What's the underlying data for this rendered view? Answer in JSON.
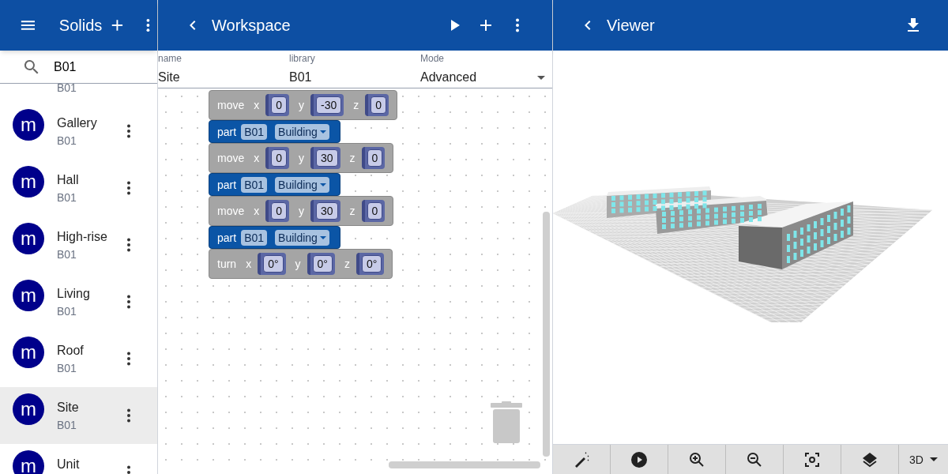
{
  "solids_panel": {
    "title": "Solids",
    "search": {
      "value": "B01"
    },
    "items": [
      {
        "subtitle": "B01",
        "selected": false
      },
      {
        "avatar": "m",
        "title": "Gallery",
        "subtitle": "B01",
        "selected": false
      },
      {
        "avatar": "m",
        "title": "Hall",
        "subtitle": "B01",
        "selected": false
      },
      {
        "avatar": "m",
        "title": "High-rise",
        "subtitle": "B01",
        "selected": false
      },
      {
        "avatar": "m",
        "title": "Living",
        "subtitle": "B01",
        "selected": false
      },
      {
        "avatar": "m",
        "title": "Roof",
        "subtitle": "B01",
        "selected": false
      },
      {
        "avatar": "m",
        "title": "Site",
        "subtitle": "B01",
        "selected": true
      },
      {
        "avatar": "m",
        "title": "Unit",
        "selected": false
      }
    ]
  },
  "workspace": {
    "title": "Workspace",
    "fields": [
      {
        "label": "name",
        "value": "Site",
        "kind": "text"
      },
      {
        "label": "library",
        "value": "B01",
        "kind": "text"
      },
      {
        "label": "Mode",
        "value": "Advanced",
        "kind": "select"
      }
    ],
    "blocks": [
      {
        "kind": "move",
        "label": "move",
        "args": [
          {
            "name": "x",
            "value": "0"
          },
          {
            "name": "y",
            "value": "-30"
          },
          {
            "name": "z",
            "value": "0"
          }
        ]
      },
      {
        "kind": "part",
        "label": "part",
        "library": "B01",
        "value": "Building"
      },
      {
        "kind": "move",
        "label": "move",
        "args": [
          {
            "name": "x",
            "value": "0"
          },
          {
            "name": "y",
            "value": "30"
          },
          {
            "name": "z",
            "value": "0"
          }
        ]
      },
      {
        "kind": "part",
        "label": "part",
        "library": "B01",
        "value": "Building"
      },
      {
        "kind": "move",
        "label": "move",
        "args": [
          {
            "name": "x",
            "value": "0"
          },
          {
            "name": "y",
            "value": "30"
          },
          {
            "name": "z",
            "value": "0"
          }
        ]
      },
      {
        "kind": "part",
        "label": "part",
        "library": "B01",
        "value": "Building"
      },
      {
        "kind": "turn",
        "label": "turn",
        "args": [
          {
            "name": "x",
            "value": "0°"
          },
          {
            "name": "y",
            "value": "0°"
          },
          {
            "name": "z",
            "value": "0°"
          }
        ]
      }
    ]
  },
  "viewer": {
    "title": "Viewer",
    "toolbar": [
      {
        "kind": "wand"
      },
      {
        "kind": "play"
      },
      {
        "kind": "zoom-in"
      },
      {
        "kind": "zoom-out"
      },
      {
        "kind": "focus"
      },
      {
        "kind": "layers"
      },
      {
        "kind": "select",
        "label": "3D"
      }
    ]
  }
}
